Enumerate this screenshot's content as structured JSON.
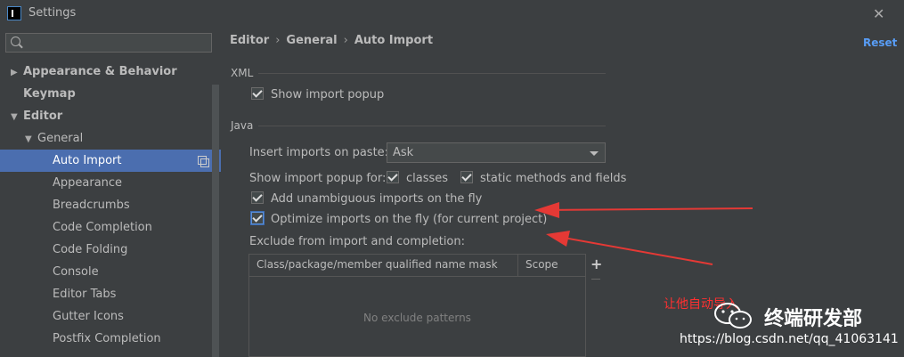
{
  "window": {
    "title": "Settings"
  },
  "search": {
    "placeholder": "",
    "value": ""
  },
  "sidebar": {
    "items": [
      {
        "label": "Appearance & Behavior",
        "arrow": "▶"
      },
      {
        "label": "Keymap",
        "arrow": ""
      },
      {
        "label": "Editor",
        "arrow": "▼"
      },
      {
        "label": "General",
        "arrow": "▼"
      },
      {
        "label": "Auto Import",
        "arrow": ""
      },
      {
        "label": "Appearance",
        "arrow": ""
      },
      {
        "label": "Breadcrumbs",
        "arrow": ""
      },
      {
        "label": "Code Completion",
        "arrow": ""
      },
      {
        "label": "Code Folding",
        "arrow": ""
      },
      {
        "label": "Console",
        "arrow": ""
      },
      {
        "label": "Editor Tabs",
        "arrow": ""
      },
      {
        "label": "Gutter Icons",
        "arrow": ""
      },
      {
        "label": "Postfix Completion",
        "arrow": ""
      }
    ]
  },
  "breadcrumb": {
    "parts": [
      "Editor",
      "General",
      "Auto Import"
    ],
    "separator": "›"
  },
  "reset_label": "Reset",
  "xml": {
    "section_label": "XML",
    "show_import_popup": {
      "label": "Show import popup",
      "checked": true
    }
  },
  "java": {
    "section_label": "Java",
    "insert_imports_label": "Insert imports on paste:",
    "insert_imports_value": "Ask",
    "show_popup_for_label": "Show import popup for:",
    "classes": {
      "label": "classes",
      "checked": true
    },
    "static_methods": {
      "label": "static methods and fields",
      "checked": true
    },
    "add_unambiguous": {
      "label": "Add unambiguous imports on the fly",
      "checked": true
    },
    "optimize_imports": {
      "label": "Optimize imports on the fly (for current project)",
      "checked": true
    },
    "exclude_label": "Exclude from import and completion:",
    "table": {
      "columns": [
        "Class/package/member qualified name mask",
        "Scope"
      ],
      "empty_text": "No exclude patterns"
    }
  },
  "annotation": {
    "cn_text": "让他自动导入",
    "brand": "终端研发部",
    "url": "https://blog.csdn.net/qq_41063141"
  },
  "colors": {
    "selection": "#4b6eaf",
    "link": "#589df6",
    "arrow": "#e53935"
  }
}
